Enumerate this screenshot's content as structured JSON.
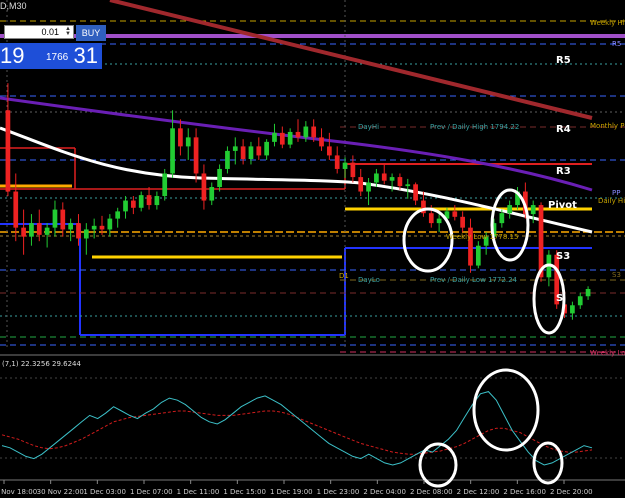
{
  "symbol_caption": "D,M30",
  "trade_panel": {
    "lot_value": "0.01",
    "buy_label": "BUY",
    "price_left": "19",
    "price_mid": "1766",
    "price_right": "31"
  },
  "colors": {
    "background": "#000000",
    "trendline": "#a0282d",
    "ma_slow": "#6a1fb5",
    "ma_fast": "#ffffff",
    "pivot": "#ffd200",
    "range_box": "#2233ff",
    "indicator_fast": "#3cc0c8",
    "indicator_slow": "#d01c1c",
    "bull_candle": "#22cc33",
    "bear_candle": "#ee2222"
  },
  "levels": {
    "r5": "R5",
    "r4": "R4",
    "r3": "R3",
    "pivot": "Pivot",
    "s3": "S3",
    "s_partial": "S",
    "weekly_high": "Weekly High",
    "monthly_pivot_partial": "Monthly P",
    "daily_hi_partial": "Daily Hi",
    "day_hi": "DayHi",
    "prev_daily_high": "Prev / Daily High 1794.22",
    "weekly_low": "Weekly Low 1778.15",
    "day_lo": "DayLo",
    "prev_daily_low": "Prev / Daily Low 1772.24",
    "weekly_low_right": "Weekly Lo",
    "d1": "D1",
    "r5_right": "R5",
    "pp_right": "PP",
    "s3_right": "S3"
  },
  "indicator_caption": "(7,1) 22.3256 29.6244",
  "time_labels": [
    "30 Nov 18:00",
    "30 Nov 22:00",
    "1 Dec 03:00",
    "1 Dec 07:00",
    "1 Dec 11:00",
    "1 Dec 15:00",
    "1 Dec 19:00",
    "1 Dec 23:00",
    "2 Dec 04:00",
    "2 Dec 08:00",
    "2 Dec 12:00",
    "2 Dec 16:00",
    "2 Dec 20:00"
  ],
  "chart_data": {
    "type": "candlestick",
    "timeframe": "M30",
    "candles": [
      {
        "o": 1790.0,
        "h": 1793.0,
        "l": 1780.5,
        "c": 1781.0
      },
      {
        "o": 1781.0,
        "h": 1783.0,
        "l": 1775.5,
        "c": 1777.0
      },
      {
        "o": 1777.0,
        "h": 1779.0,
        "l": 1774.0,
        "c": 1776.0
      },
      {
        "o": 1776.0,
        "h": 1778.5,
        "l": 1775.0,
        "c": 1777.5
      },
      {
        "o": 1777.5,
        "h": 1779.0,
        "l": 1775.5,
        "c": 1776.2
      },
      {
        "o": 1776.2,
        "h": 1777.5,
        "l": 1774.8,
        "c": 1777.0
      },
      {
        "o": 1777.0,
        "h": 1780.0,
        "l": 1776.0,
        "c": 1779.0
      },
      {
        "o": 1779.0,
        "h": 1779.8,
        "l": 1776.0,
        "c": 1776.8
      },
      {
        "o": 1776.8,
        "h": 1778.0,
        "l": 1775.5,
        "c": 1777.5
      },
      {
        "o": 1777.5,
        "h": 1778.5,
        "l": 1775.0,
        "c": 1775.8
      },
      {
        "o": 1775.8,
        "h": 1777.5,
        "l": 1774.0,
        "c": 1776.8
      },
      {
        "o": 1776.8,
        "h": 1778.0,
        "l": 1775.8,
        "c": 1777.2
      },
      {
        "o": 1777.2,
        "h": 1778.3,
        "l": 1776.2,
        "c": 1776.8
      },
      {
        "o": 1776.8,
        "h": 1778.5,
        "l": 1776.0,
        "c": 1778.0
      },
      {
        "o": 1778.0,
        "h": 1779.2,
        "l": 1777.0,
        "c": 1778.8
      },
      {
        "o": 1778.8,
        "h": 1780.5,
        "l": 1778.0,
        "c": 1780.0
      },
      {
        "o": 1780.0,
        "h": 1780.5,
        "l": 1778.5,
        "c": 1779.2
      },
      {
        "o": 1779.2,
        "h": 1781.0,
        "l": 1778.8,
        "c": 1780.6
      },
      {
        "o": 1780.6,
        "h": 1781.5,
        "l": 1779.0,
        "c": 1779.5
      },
      {
        "o": 1779.5,
        "h": 1781.0,
        "l": 1779.0,
        "c": 1780.5
      },
      {
        "o": 1780.5,
        "h": 1783.5,
        "l": 1780.0,
        "c": 1783.0
      },
      {
        "o": 1783.0,
        "h": 1790.0,
        "l": 1782.5,
        "c": 1788.0
      },
      {
        "o": 1788.0,
        "h": 1789.0,
        "l": 1785.0,
        "c": 1786.0
      },
      {
        "o": 1786.0,
        "h": 1788.0,
        "l": 1784.5,
        "c": 1787.0
      },
      {
        "o": 1787.0,
        "h": 1788.0,
        "l": 1782.0,
        "c": 1783.0
      },
      {
        "o": 1783.0,
        "h": 1784.0,
        "l": 1779.0,
        "c": 1780.0
      },
      {
        "o": 1780.0,
        "h": 1782.0,
        "l": 1779.5,
        "c": 1781.5
      },
      {
        "o": 1781.5,
        "h": 1784.0,
        "l": 1781.0,
        "c": 1783.5
      },
      {
        "o": 1783.5,
        "h": 1786.0,
        "l": 1783.0,
        "c": 1785.5
      },
      {
        "o": 1785.5,
        "h": 1787.0,
        "l": 1784.0,
        "c": 1786.0
      },
      {
        "o": 1786.0,
        "h": 1786.8,
        "l": 1784.0,
        "c": 1784.6
      },
      {
        "o": 1784.6,
        "h": 1786.5,
        "l": 1784.0,
        "c": 1786.0
      },
      {
        "o": 1786.0,
        "h": 1787.0,
        "l": 1784.5,
        "c": 1785.0
      },
      {
        "o": 1785.0,
        "h": 1786.8,
        "l": 1784.5,
        "c": 1786.5
      },
      {
        "o": 1786.5,
        "h": 1788.5,
        "l": 1786.0,
        "c": 1787.5
      },
      {
        "o": 1787.5,
        "h": 1788.2,
        "l": 1785.8,
        "c": 1786.2
      },
      {
        "o": 1786.2,
        "h": 1788.0,
        "l": 1785.8,
        "c": 1787.6
      },
      {
        "o": 1787.6,
        "h": 1789.0,
        "l": 1786.5,
        "c": 1787.0
      },
      {
        "o": 1787.0,
        "h": 1788.8,
        "l": 1786.5,
        "c": 1788.2
      },
      {
        "o": 1788.2,
        "h": 1789.0,
        "l": 1786.5,
        "c": 1787.0
      },
      {
        "o": 1787.0,
        "h": 1788.0,
        "l": 1785.5,
        "c": 1786.0
      },
      {
        "o": 1786.0,
        "h": 1787.5,
        "l": 1784.5,
        "c": 1785.0
      },
      {
        "o": 1785.0,
        "h": 1786.0,
        "l": 1783.0,
        "c": 1783.5
      },
      {
        "o": 1783.5,
        "h": 1784.8,
        "l": 1782.5,
        "c": 1784.2
      },
      {
        "o": 1784.2,
        "h": 1785.0,
        "l": 1782.0,
        "c": 1782.6
      },
      {
        "o": 1782.6,
        "h": 1783.5,
        "l": 1780.5,
        "c": 1781.0
      },
      {
        "o": 1781.0,
        "h": 1782.5,
        "l": 1779.5,
        "c": 1782.0
      },
      {
        "o": 1782.0,
        "h": 1783.5,
        "l": 1781.5,
        "c": 1783.0
      },
      {
        "o": 1783.0,
        "h": 1784.0,
        "l": 1781.8,
        "c": 1782.2
      },
      {
        "o": 1782.2,
        "h": 1783.0,
        "l": 1781.0,
        "c": 1782.6
      },
      {
        "o": 1782.6,
        "h": 1783.0,
        "l": 1781.2,
        "c": 1781.6
      },
      {
        "o": 1781.6,
        "h": 1782.4,
        "l": 1780.2,
        "c": 1781.8
      },
      {
        "o": 1781.8,
        "h": 1782.0,
        "l": 1779.5,
        "c": 1780.0
      },
      {
        "o": 1780.0,
        "h": 1781.0,
        "l": 1778.2,
        "c": 1778.6
      },
      {
        "o": 1778.6,
        "h": 1779.5,
        "l": 1777.0,
        "c": 1777.5
      },
      {
        "o": 1777.5,
        "h": 1778.5,
        "l": 1776.5,
        "c": 1778.0
      },
      {
        "o": 1778.0,
        "h": 1779.2,
        "l": 1777.5,
        "c": 1778.8
      },
      {
        "o": 1778.8,
        "h": 1779.5,
        "l": 1777.8,
        "c": 1778.2
      },
      {
        "o": 1778.2,
        "h": 1778.8,
        "l": 1776.5,
        "c": 1777.0
      },
      {
        "o": 1777.0,
        "h": 1778.0,
        "l": 1772.0,
        "c": 1772.8
      },
      {
        "o": 1772.8,
        "h": 1775.5,
        "l": 1772.5,
        "c": 1775.0
      },
      {
        "o": 1775.0,
        "h": 1776.5,
        "l": 1774.0,
        "c": 1776.0
      },
      {
        "o": 1776.0,
        "h": 1778.0,
        "l": 1775.5,
        "c": 1777.5
      },
      {
        "o": 1777.5,
        "h": 1779.0,
        "l": 1777.0,
        "c": 1778.6
      },
      {
        "o": 1778.6,
        "h": 1780.0,
        "l": 1778.0,
        "c": 1779.5
      },
      {
        "o": 1779.5,
        "h": 1781.5,
        "l": 1779.0,
        "c": 1781.0
      },
      {
        "o": 1781.0,
        "h": 1782.0,
        "l": 1778.0,
        "c": 1778.5
      },
      {
        "o": 1778.5,
        "h": 1780.0,
        "l": 1777.5,
        "c": 1779.5
      },
      {
        "o": 1779.5,
        "h": 1779.8,
        "l": 1771.0,
        "c": 1771.5
      },
      {
        "o": 1771.5,
        "h": 1774.5,
        "l": 1770.5,
        "c": 1774.0
      },
      {
        "o": 1774.0,
        "h": 1774.5,
        "l": 1768.0,
        "c": 1768.5
      },
      {
        "o": 1768.5,
        "h": 1769.5,
        "l": 1767.0,
        "c": 1767.5
      },
      {
        "o": 1767.5,
        "h": 1768.8,
        "l": 1766.8,
        "c": 1768.4
      },
      {
        "o": 1768.4,
        "h": 1769.8,
        "l": 1768.0,
        "c": 1769.4
      },
      {
        "o": 1769.4,
        "h": 1770.5,
        "l": 1769.0,
        "c": 1770.2
      }
    ],
    "indicator_fast": [
      30,
      28,
      24,
      20,
      18,
      22,
      28,
      34,
      40,
      46,
      52,
      58,
      55,
      60,
      66,
      62,
      58,
      55,
      60,
      64,
      70,
      74,
      72,
      68,
      62,
      56,
      52,
      50,
      54,
      60,
      66,
      70,
      74,
      76,
      72,
      68,
      62,
      56,
      50,
      44,
      38,
      32,
      28,
      24,
      20,
      18,
      22,
      18,
      14,
      12,
      14,
      18,
      22,
      26,
      24,
      30,
      36,
      44,
      56,
      68,
      78,
      80,
      72,
      58,
      44,
      34,
      24,
      16,
      12,
      14,
      18,
      22,
      26,
      30,
      28
    ],
    "indicator_slow": [
      40,
      38,
      36,
      33,
      30,
      28,
      27,
      28,
      30,
      33,
      36,
      40,
      44,
      48,
      52,
      54,
      56,
      57,
      58,
      59,
      60,
      61,
      62,
      62,
      61,
      60,
      59,
      58,
      58,
      58,
      59,
      60,
      61,
      62,
      62,
      61,
      59,
      56,
      53,
      50,
      47,
      44,
      41,
      38,
      35,
      32,
      30,
      28,
      26,
      24,
      23,
      22,
      22,
      23,
      24,
      25,
      27,
      29,
      32,
      36,
      40,
      44,
      46,
      46,
      44,
      42,
      38,
      34,
      30,
      27,
      25,
      24,
      24,
      25,
      26
    ]
  }
}
